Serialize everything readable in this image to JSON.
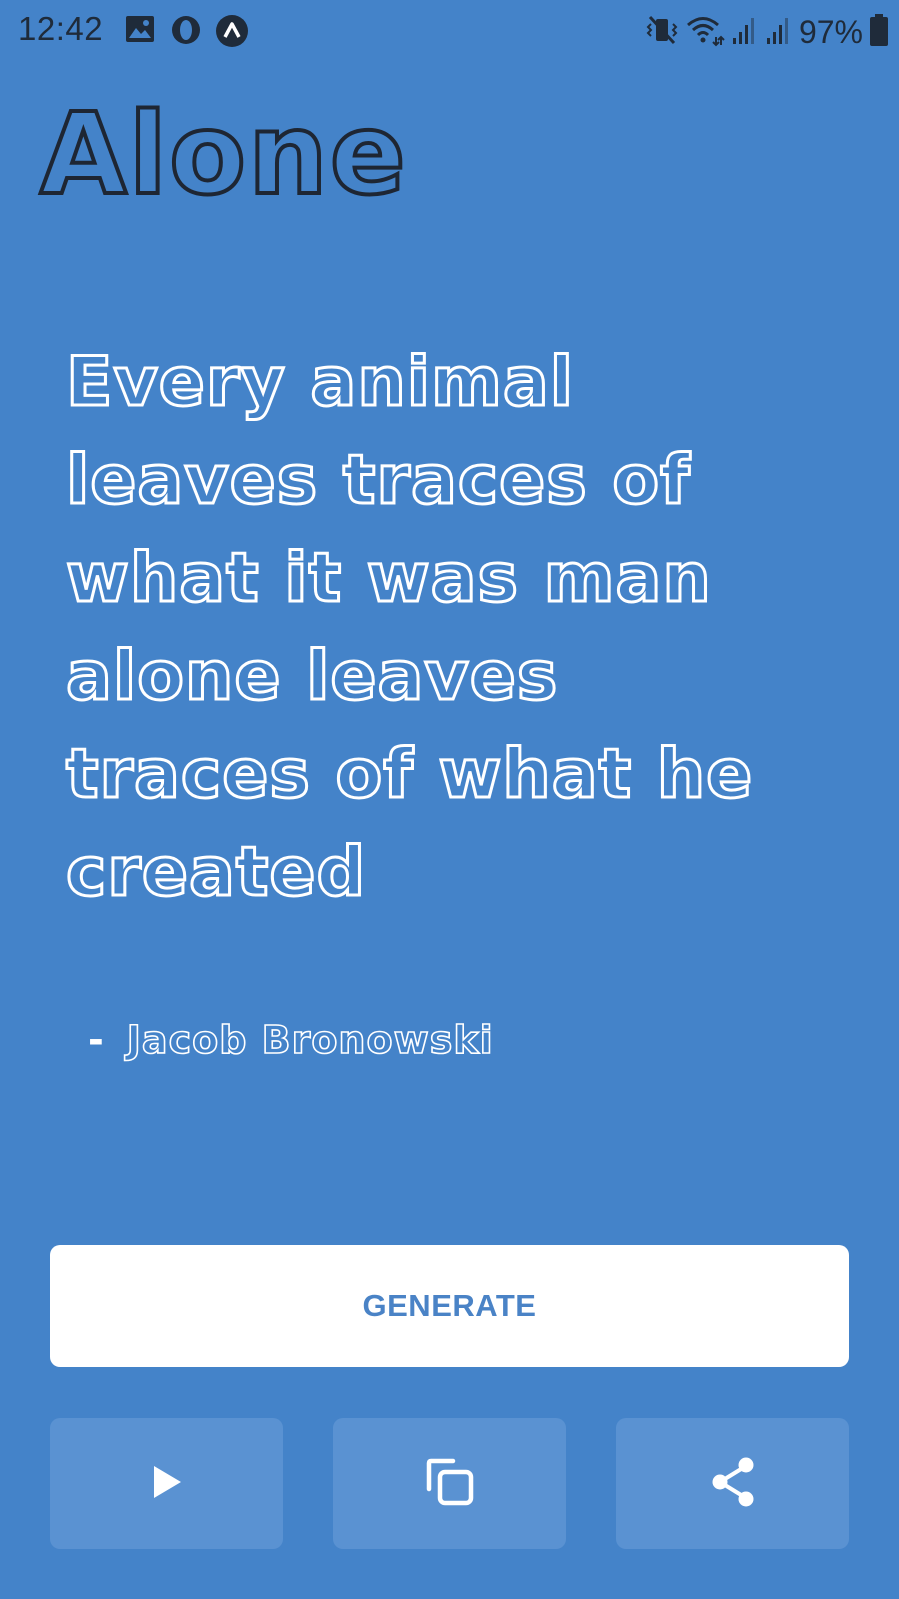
{
  "status_bar": {
    "time": "12:42",
    "battery": "97%",
    "left_icons": [
      "image-icon",
      "opera-icon",
      "app-a-icon"
    ],
    "right_icons": [
      "vibrate-icon",
      "wifi-icon",
      "signal-icon",
      "signal-icon-2",
      "battery-icon"
    ]
  },
  "app": {
    "title": "Alone"
  },
  "quote": {
    "text": "Every animal leaves traces of what it was man alone leaves traces of what he created",
    "dash": "-",
    "author": "Jacob Bronowski"
  },
  "actions": {
    "generate_label": "GENERATE",
    "play_icon": "play-icon",
    "copy_icon": "copy-icon",
    "share_icon": "share-icon"
  },
  "colors": {
    "background": "#4483c9",
    "button": "#ffffff",
    "button_text": "#4a83c6",
    "secondary_button": "#5a92d2"
  }
}
